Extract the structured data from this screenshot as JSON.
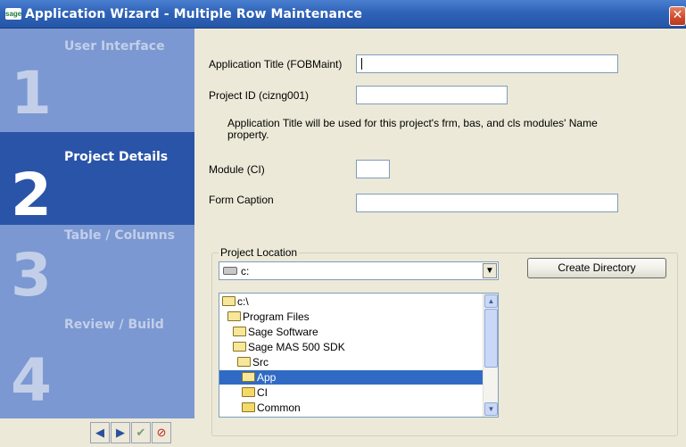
{
  "window": {
    "title": "Application Wizard - Multiple Row Maintenance",
    "logo_text": "sage",
    "close_glyph": "✕"
  },
  "steps": [
    {
      "number": "1",
      "label": "User Interface",
      "active": false
    },
    {
      "number": "2",
      "label": "Project Details",
      "active": true
    },
    {
      "number": "3",
      "label": "Table / Columns",
      "active": false
    },
    {
      "number": "4",
      "label": "Review / Build",
      "active": false
    }
  ],
  "nav": {
    "prev_icon": "left-arrow-icon",
    "next_icon": "right-arrow-icon",
    "finish_icon": "checkmark-icon",
    "cancel_icon": "cancel-icon"
  },
  "form": {
    "app_title_label": "Application Title (FOBMaint)",
    "app_title_value": "",
    "project_id_label": "Project ID (cizng001)",
    "project_id_value": "",
    "note": "Application Title will be used for this project's frm, bas, and cls modules' Name property.",
    "module_label": "Module (CI)",
    "module_value": "",
    "form_caption_label": "Form Caption",
    "form_caption_value": ""
  },
  "project_location": {
    "group_title": "Project Location",
    "drive_value": "c:",
    "create_dir_label": "Create Directory",
    "directories": [
      {
        "name": "c:\\",
        "open": true,
        "selected": false
      },
      {
        "name": "Program Files",
        "open": true,
        "selected": false
      },
      {
        "name": "Sage Software",
        "open": true,
        "selected": false
      },
      {
        "name": "Sage MAS 500 SDK",
        "open": true,
        "selected": false
      },
      {
        "name": "Src",
        "open": true,
        "selected": false
      },
      {
        "name": "App",
        "open": true,
        "selected": true
      },
      {
        "name": "CI",
        "open": false,
        "selected": false
      },
      {
        "name": "Common",
        "open": false,
        "selected": false
      }
    ]
  },
  "colors": {
    "title_bar": "#2f63b8",
    "sidebar": "#7b98d2",
    "active_step": "#2a54a8",
    "selection": "#316ac5"
  }
}
